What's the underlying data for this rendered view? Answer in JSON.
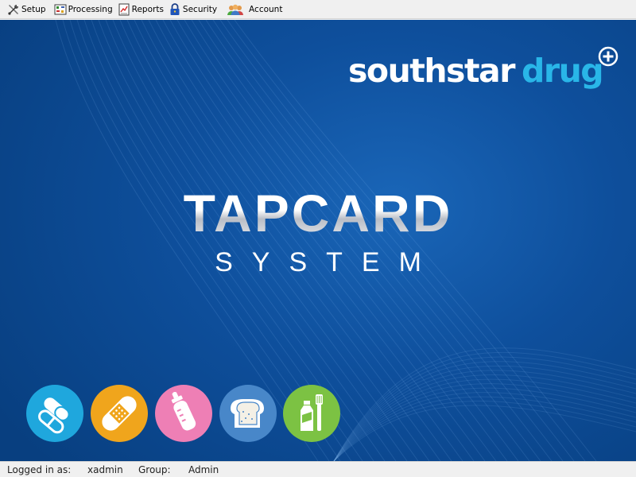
{
  "menu": {
    "items": [
      {
        "label": "Setup",
        "icon": "tools-icon"
      },
      {
        "label": "Processing",
        "icon": "processing-icon"
      },
      {
        "label": "Reports",
        "icon": "report-icon"
      },
      {
        "label": "Security",
        "icon": "lock-icon"
      },
      {
        "label": "Account",
        "icon": "users-icon"
      }
    ]
  },
  "splash": {
    "brand_primary": "southstar",
    "brand_secondary": "drug",
    "title": "TAPCARD",
    "subtitle": "SYSTEM",
    "category_icons": [
      {
        "name": "pills-icon",
        "color": "#1fa7dd"
      },
      {
        "name": "bandage-icon",
        "color": "#f0a51c"
      },
      {
        "name": "baby-bottle-icon",
        "color": "#ee7fb5"
      },
      {
        "name": "bread-icon",
        "color": "#4887c9"
      },
      {
        "name": "toothpaste-brush-icon",
        "color": "#7cc243"
      }
    ]
  },
  "status": {
    "logged_in_label": "Logged in as:",
    "user": "xadmin",
    "group_label": "Group:",
    "group": "Admin"
  },
  "colors": {
    "background_blue": "#0e4f9c",
    "brand_accent": "#29b6e8",
    "menu_bg": "#f0f0f0"
  }
}
